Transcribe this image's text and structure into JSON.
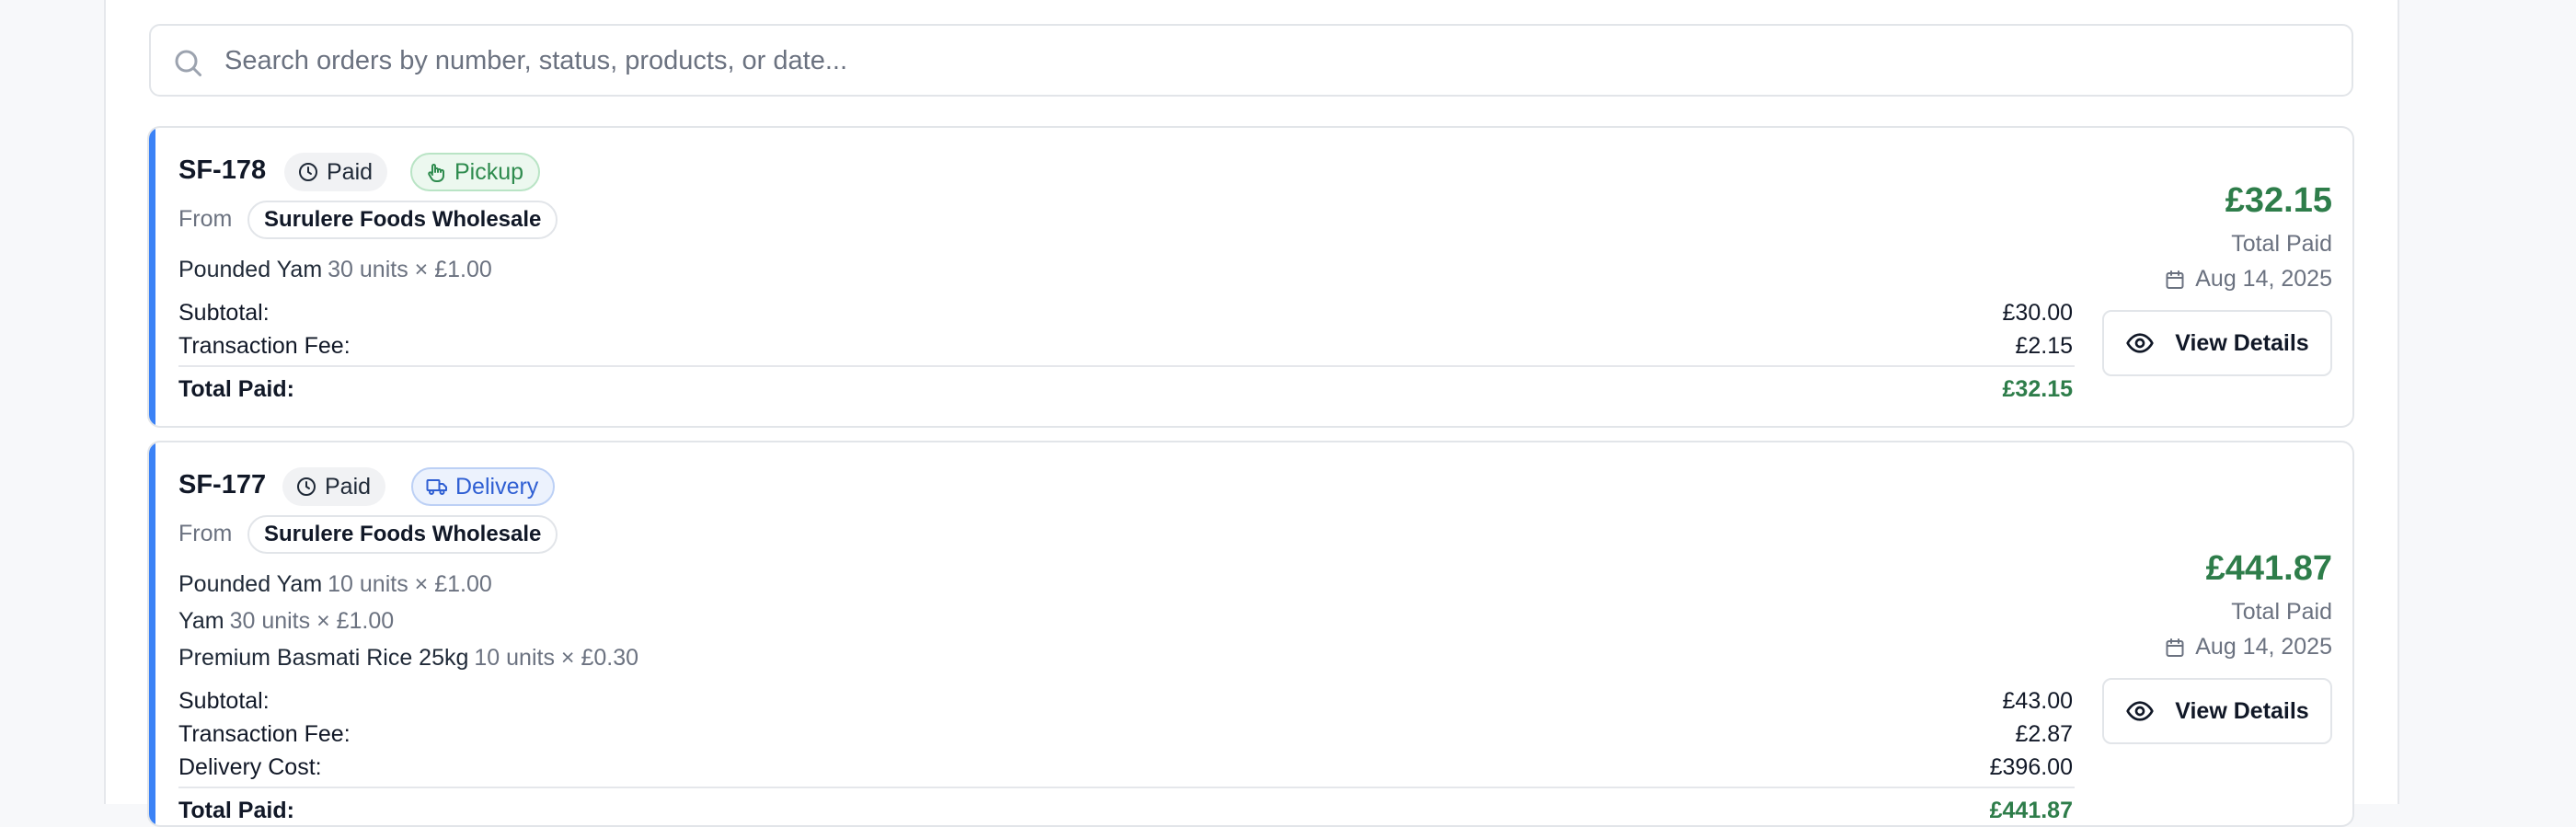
{
  "search": {
    "placeholder": "Search orders by number, status, products, or date..."
  },
  "colors": {
    "accent": "#3b82f6",
    "paid_total": "#2e7d4a",
    "pickup": "#2e8b4e",
    "delivery": "#2f5fd3"
  },
  "orders": [
    {
      "id": "SF-178",
      "status": "Paid",
      "method": "Pickup",
      "method_icon": "hand-icon",
      "from_label": "From",
      "vendor": "Surulere Foods Wholesale",
      "items": [
        {
          "name": "Pounded Yam",
          "detail": "30 units × £1.00"
        }
      ],
      "summary": [
        {
          "label": "Subtotal:",
          "value": "£30.00"
        },
        {
          "label": "Transaction Fee:",
          "value": "£2.15"
        }
      ],
      "total_label": "Total Paid:",
      "total_value": "£32.15",
      "big_total": "£32.15",
      "total_caption": "Total Paid",
      "date": "Aug 14, 2025",
      "view_label": "View Details"
    },
    {
      "id": "SF-177",
      "status": "Paid",
      "method": "Delivery",
      "method_icon": "truck-icon",
      "from_label": "From",
      "vendor": "Surulere Foods Wholesale",
      "items": [
        {
          "name": "Pounded Yam",
          "detail": "10 units × £1.00"
        },
        {
          "name": "Yam",
          "detail": "30 units × £1.00"
        },
        {
          "name": "Premium Basmati Rice 25kg",
          "detail": "10 units × £0.30"
        }
      ],
      "summary": [
        {
          "label": "Subtotal:",
          "value": "£43.00"
        },
        {
          "label": "Transaction Fee:",
          "value": "£2.87"
        },
        {
          "label": "Delivery Cost:",
          "value": "£396.00"
        }
      ],
      "total_label": "Total Paid:",
      "total_value": "£441.87",
      "big_total": "£441.87",
      "total_caption": "Total Paid",
      "date": "Aug 14, 2025",
      "view_label": "View Details"
    }
  ]
}
